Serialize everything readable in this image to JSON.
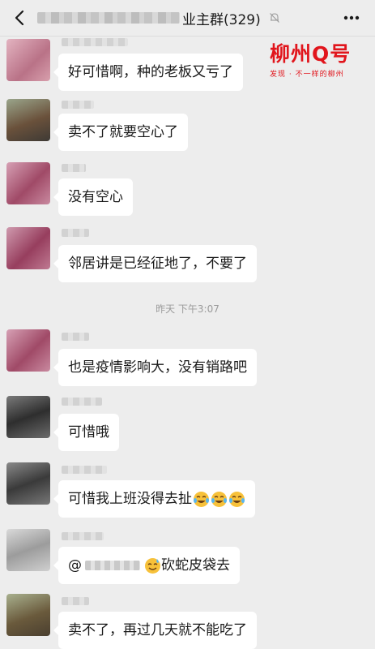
{
  "header": {
    "title_suffix": "业主群(329)"
  },
  "watermark": {
    "brand": "柳州Q号",
    "slogan": "发现 · 不一样的柳州"
  },
  "timestamp": "昨天 下午3:07",
  "messages": [
    {
      "text": "好可惜啊，种的老板又亏了",
      "avatar_color": "#c9889a"
    },
    {
      "text": "卖不了就要空心了",
      "avatar_color": "#7d6148"
    },
    {
      "text": "没有空心",
      "avatar_color": "#b0607a"
    },
    {
      "text": "邻居讲是已经征地了，不要了",
      "avatar_color": "#a55a6e"
    },
    {
      "text": "也是疫情影响大，没有销路吧",
      "avatar_color": "#b0607a"
    },
    {
      "text": "可惜哦",
      "avatar_color": "#4a4a4a"
    },
    {
      "text": "可惜我上班没得去扯",
      "avatar_color": "#555555",
      "emoji": "tears-of-joy-emoji"
    },
    {
      "text_prefix": "@",
      "text_suffix": "砍蛇皮袋去",
      "avatar_color": "#bdbdbd",
      "emoji": "sweat-smile-emoji"
    },
    {
      "text": "卖不了，再过几天就不能吃了",
      "avatar_color": "#7a6a4a"
    }
  ]
}
